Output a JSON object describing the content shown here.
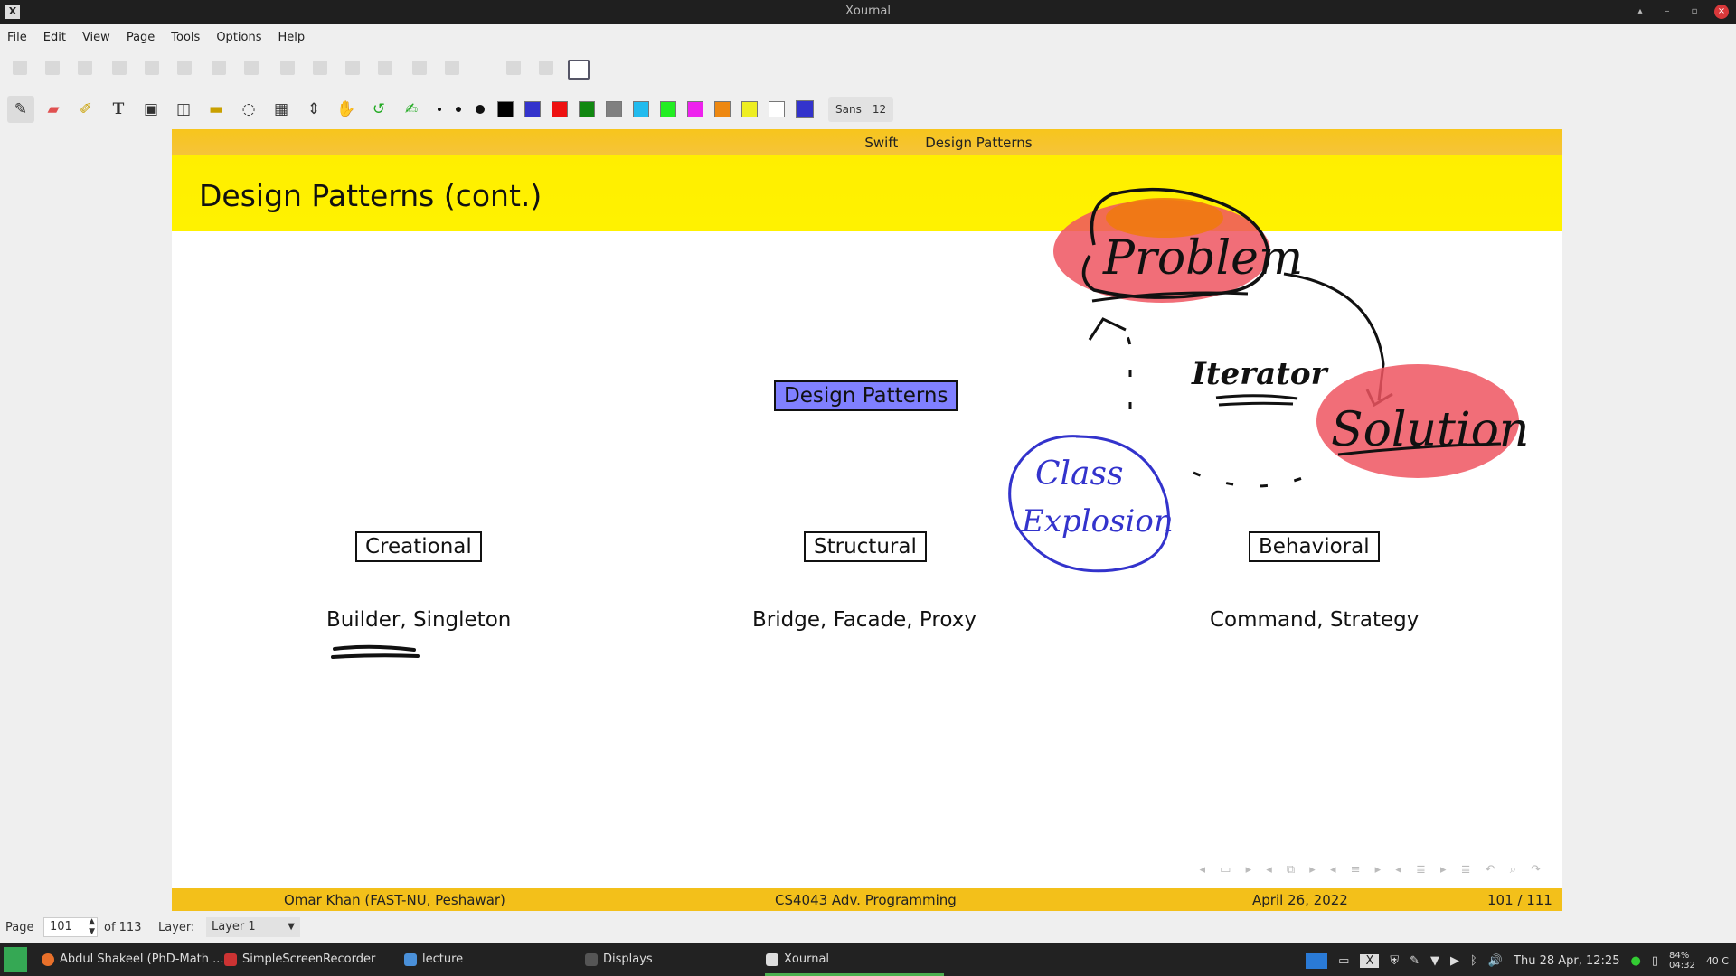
{
  "window": {
    "title": "Xournal"
  },
  "menu": [
    "File",
    "Edit",
    "View",
    "Page",
    "Tools",
    "Options",
    "Help"
  ],
  "toolbar": {
    "font_name": "Sans",
    "font_size": "12"
  },
  "colors": {
    "swatches": [
      "#000000",
      "#3333cc",
      "#ee1111",
      "#118811",
      "#808080",
      "#22bbee",
      "#22ee22",
      "#ee22ee",
      "#ee8811",
      "#eeee22",
      "#ffffff"
    ],
    "current": "#3333cc"
  },
  "slide": {
    "nav_section": "Swift",
    "nav_subsection": "Design Patterns",
    "title": "Design Patterns (cont.)",
    "center_box": "Design Patterns",
    "categories": [
      {
        "label": "Creational",
        "examples": "Builder, Singleton"
      },
      {
        "label": "Structural",
        "examples": "Bridge, Facade, Proxy"
      },
      {
        "label": "Behavioral",
        "examples": "Command, Strategy"
      }
    ],
    "annotations": {
      "problem": "Problem",
      "solution": "Solution",
      "iterator": "Iterator",
      "class": "Class",
      "explosion": "Explosion"
    },
    "footer": {
      "author": "Omar Khan  (FAST-NU, Peshawar)",
      "course": "CS4043 Adv. Programming",
      "date": "April 26, 2022",
      "pages": "101 / 111"
    }
  },
  "status": {
    "page_label": "Page",
    "page_value": "101",
    "page_of": "of 113",
    "layer_label": "Layer:",
    "layer_value": "Layer 1"
  },
  "taskbar": {
    "tasks": [
      "Abdul Shakeel (PhD-Math ...",
      "SimpleScreenRecorder",
      "lecture",
      "Displays",
      "Xournal"
    ],
    "clock": "Thu 28 Apr, 12:25",
    "battery": "84%",
    "battery_time": "04:32",
    "temp": "40 C"
  }
}
